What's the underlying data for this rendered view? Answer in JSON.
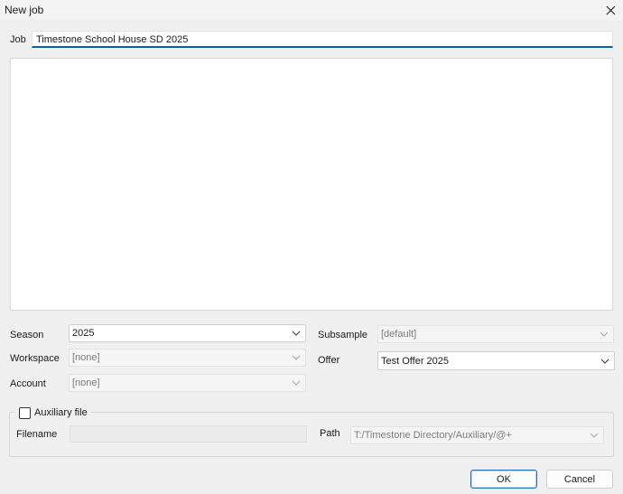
{
  "window": {
    "title": "New job"
  },
  "job": {
    "label": "Job",
    "value": "Timestone School House SD 2025"
  },
  "season": {
    "label": "Season",
    "value": "2025"
  },
  "workspace": {
    "label": "Workspace",
    "value": "[none]"
  },
  "account": {
    "label": "Account",
    "value": "[none]"
  },
  "subsample": {
    "label": "Subsample",
    "value": "[default]"
  },
  "offer": {
    "label": "Offer",
    "value": "Test Offer 2025"
  },
  "auxiliary": {
    "checkbox_label": "Auxiliary file",
    "checked": false,
    "filename_label": "Filename",
    "filename_value": "",
    "path_label": "Path",
    "path_value": "T:/Timestone Directory/Auxiliary/@+"
  },
  "buttons": {
    "ok": "OK",
    "cancel": "Cancel"
  },
  "icons": {
    "close": "close-icon",
    "chevron": "chevron-down-icon"
  }
}
